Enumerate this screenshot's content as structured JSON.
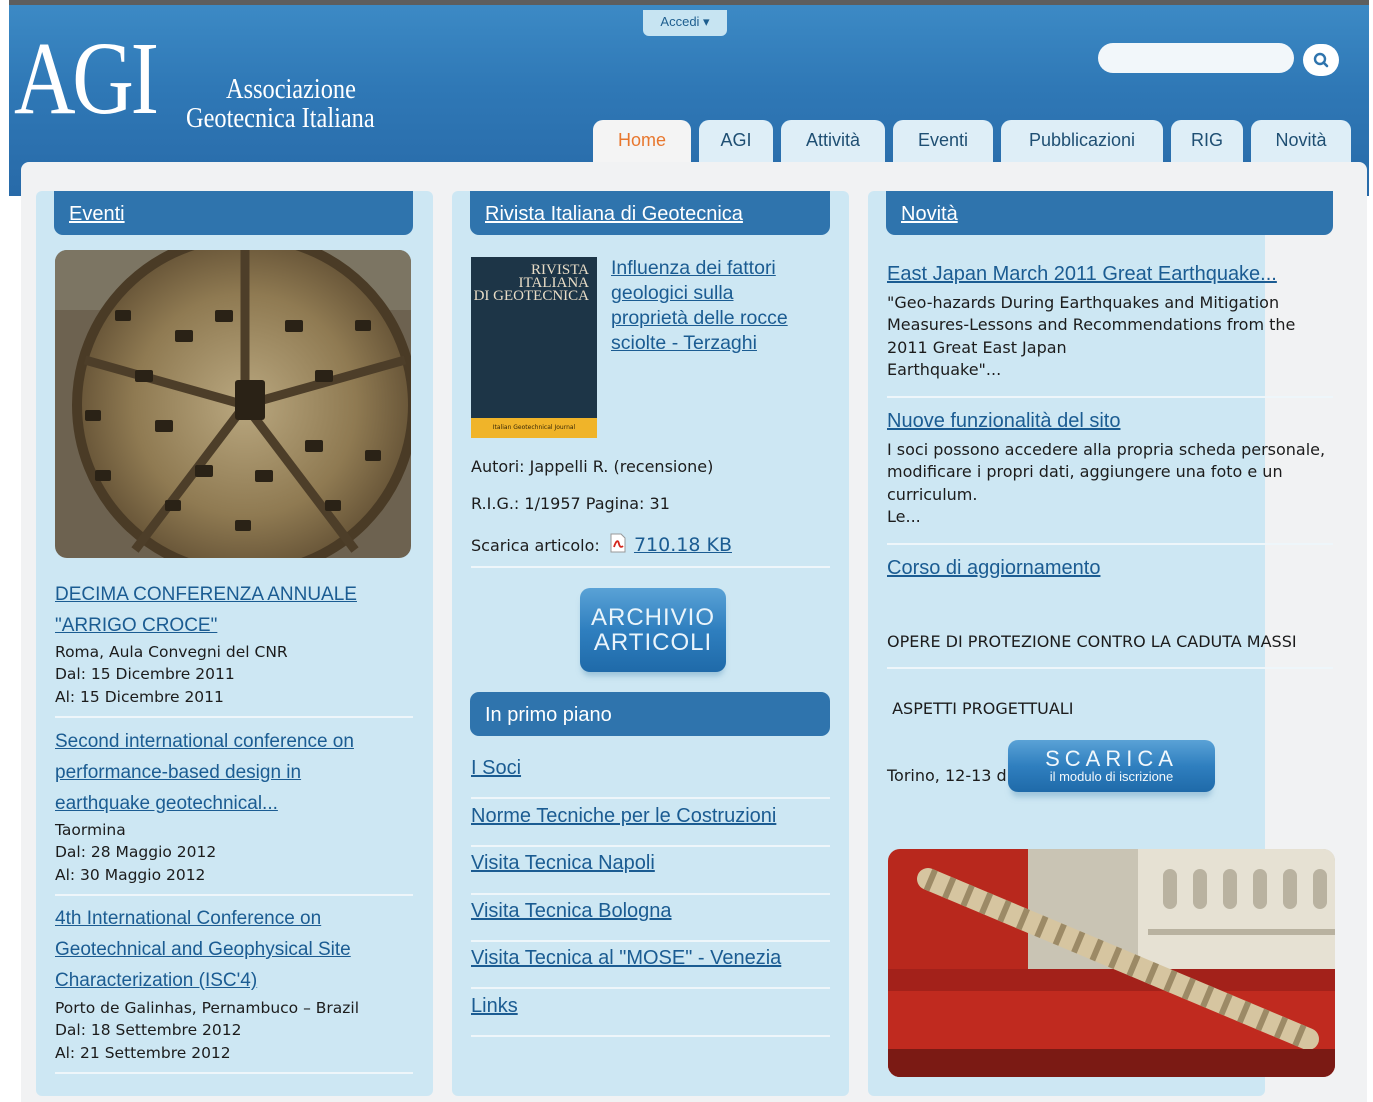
{
  "header": {
    "login_label": "Accedi ▾",
    "logo_text": "AGI",
    "logo_line1": "Associazione",
    "logo_line2": "Geotecnica Italiana",
    "search_placeholder": ""
  },
  "nav": {
    "tabs": [
      {
        "label": "Home",
        "active": true
      },
      {
        "label": "AGI"
      },
      {
        "label": "Attività"
      },
      {
        "label": "Eventi"
      },
      {
        "label": "Pubblicazioni"
      },
      {
        "label": "RIG"
      },
      {
        "label": "Novità"
      }
    ]
  },
  "eventi": {
    "title": "Eventi",
    "items": [
      {
        "title_lines": [
          "DECIMA CONFERENZA ANNUALE",
          "\"ARRIGO CROCE\""
        ],
        "place": "Roma, Aula Convegni del CNR",
        "from": "Dal: 15 Dicembre 2011",
        "to": "Al: 15 Dicembre 2011"
      },
      {
        "title_lines": [
          "Second international conference on",
          "performance-based design in",
          "earthquake geotechnical..."
        ],
        "place": "Taormina",
        "from": "Dal: 28 Maggio 2012",
        "to": "Al: 30 Maggio 2012"
      },
      {
        "title_lines": [
          "4th International Conference on",
          "Geotechnical and Geophysical Site",
          "Characterization (ISC'4)"
        ],
        "place": "Porto de Galinhas, Pernambuco – Brazil",
        "from": "Dal: 18 Settembre 2012",
        "to": "Al: 21 Settembre 2012"
      }
    ]
  },
  "rivista": {
    "title": "Rivista Italiana di Geotecnica",
    "cover_title": [
      "RIVISTA",
      "ITALIANA",
      "DI GEOTECNICA"
    ],
    "cover_footer": "Italian Geotechnical Journal",
    "article_lines": [
      "Influenza dei fattori",
      "geologici sulla",
      "proprietà delle rocce",
      "sciolte - Terzaghi"
    ],
    "authors": "Autori: Jappelli R. (recensione)",
    "rig": "R.I.G.: 1/1957  Pagina: 31",
    "download_label": "Scarica articolo:",
    "download_size": "710.18 KB",
    "archive_line1": "ARCHIVIO",
    "archive_line2": "ARTICOLI"
  },
  "primo_piano": {
    "title": "In primo piano",
    "links": [
      "I Soci",
      "Norme Tecniche per le Costruzioni",
      "Visita Tecnica Napoli",
      "Visita Tecnica Bologna",
      "Visita Tecnica al \"MOSE\" - Venezia",
      "Links"
    ]
  },
  "novita": {
    "title": "Novità",
    "items": [
      {
        "title": "East Japan March 2011 Great Earthquake...",
        "text_lines": [
          "\"Geo-hazards During Earthquakes and Mitigation",
          "Measures-Lessons and Recommendations from the",
          "2011 Great East Japan",
          "Earthquake\"..."
        ]
      },
      {
        "title": "Nuove funzionalità del sito",
        "text_lines": [
          "I soci possono accedere alla propria scheda personale,",
          "modificare i propri dati, aggiungere una foto e un",
          "curriculum.",
          "Le..."
        ]
      },
      {
        "title": "Corso di aggiornamento",
        "text_lines": [
          "OPERE DI PROTEZIONE CONTRO LA CADUTA MASSI",
          " ASPETTI PROGETTUALI",
          "Torino, 12-13 dicembre 2011"
        ]
      }
    ],
    "scarica_big": "SCARICA",
    "scarica_small": "il modulo di iscrizione"
  }
}
